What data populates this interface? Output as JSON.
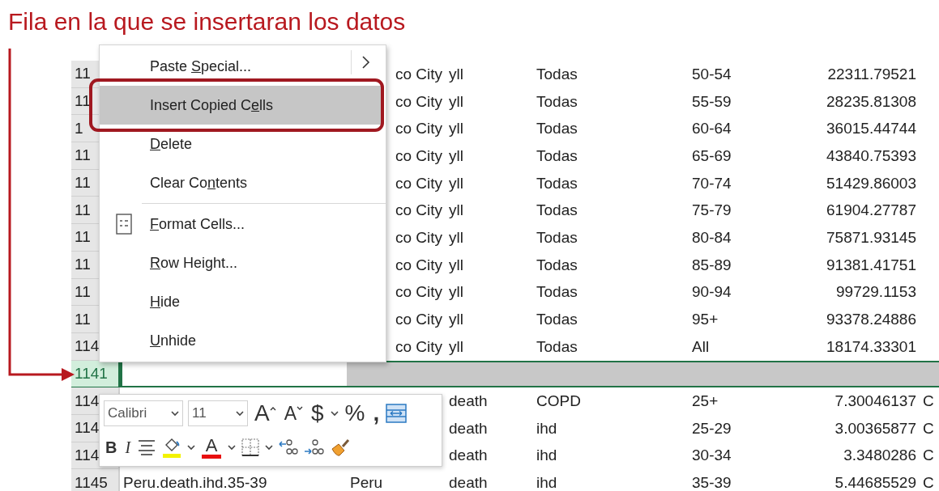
{
  "annotation": {
    "title": "Fila en la que se insertaran los datos"
  },
  "sheet": {
    "rows": [
      {
        "number": "11",
        "selected": false,
        "cut_left": true,
        "cells": {
          "c": "co City",
          "d": "yll",
          "e": "Todas",
          "f": "50-54",
          "g": "22311.79521"
        }
      },
      {
        "number": "11",
        "selected": false,
        "cut_left": true,
        "cells": {
          "c": "co City",
          "d": "yll",
          "e": "Todas",
          "f": "55-59",
          "g": "28235.81308"
        }
      },
      {
        "number": "1",
        "selected": false,
        "cut_left": true,
        "cells": {
          "c": "co City",
          "d": "yll",
          "e": "Todas",
          "f": "60-64",
          "g": "36015.44744"
        }
      },
      {
        "number": "11",
        "selected": false,
        "cut_left": true,
        "cells": {
          "c": "co City",
          "d": "yll",
          "e": "Todas",
          "f": "65-69",
          "g": "43840.75393"
        }
      },
      {
        "number": "11",
        "selected": false,
        "cut_left": true,
        "cells": {
          "c": "co City",
          "d": "yll",
          "e": "Todas",
          "f": "70-74",
          "g": "51429.86003"
        }
      },
      {
        "number": "11",
        "selected": false,
        "cut_left": true,
        "cells": {
          "c": "co City",
          "d": "yll",
          "e": "Todas",
          "f": "75-79",
          "g": "61904.27787"
        }
      },
      {
        "number": "11",
        "selected": false,
        "cut_left": true,
        "cells": {
          "c": "co City",
          "d": "yll",
          "e": "Todas",
          "f": "80-84",
          "g": "75871.93145"
        }
      },
      {
        "number": "11",
        "selected": false,
        "cut_left": true,
        "cells": {
          "c": "co City",
          "d": "yll",
          "e": "Todas",
          "f": "85-89",
          "g": "91381.41751"
        }
      },
      {
        "number": "11",
        "selected": false,
        "cut_left": true,
        "cells": {
          "c": "co City",
          "d": "yll",
          "e": "Todas",
          "f": "90-94",
          "g": "99729.1153"
        }
      },
      {
        "number": "11",
        "selected": false,
        "cut_left": true,
        "cells": {
          "c": "co City",
          "d": "yll",
          "e": "Todas",
          "f": "95+",
          "g": "93378.24886"
        }
      },
      {
        "number": "114",
        "selected": false,
        "cut_left": true,
        "cells": {
          "c": "co City",
          "d": "yll",
          "e": "Todas",
          "f": "All",
          "g": "18174.33301"
        }
      },
      {
        "number": "1141",
        "selected": true,
        "cells": {}
      },
      {
        "number": "114",
        "selected": false,
        "cells": {
          "d": "death",
          "e": "COPD",
          "f": "25+",
          "g": "7.30046137",
          "h": "C"
        }
      },
      {
        "number": "114",
        "selected": false,
        "cells": {
          "d": "death",
          "e": "ihd",
          "f": "25-29",
          "g": "3.00365877",
          "h": "C"
        }
      },
      {
        "number": "114",
        "selected": false,
        "cells": {
          "d": "death",
          "e": "ihd",
          "f": "30-34",
          "g": "3.3480286",
          "h": "C"
        }
      },
      {
        "number": "1145",
        "selected": false,
        "cells": {
          "b": "Peru.death.ihd.35-39",
          "c": "Peru",
          "d": "death",
          "e": "ihd",
          "f": "35-39",
          "g": "5.44685529",
          "h": "C"
        }
      }
    ]
  },
  "context_menu": {
    "items": [
      {
        "kind": "item",
        "before_key": "Paste ",
        "access_key": "S",
        "after_key": "pecial...",
        "highlighted": false,
        "submenu": true
      },
      {
        "kind": "item",
        "before_key": "Insert Copied C",
        "access_key": "e",
        "after_key": "lls",
        "highlighted": true,
        "framed": true
      },
      {
        "kind": "item",
        "access_key": "D",
        "after_key": "elete",
        "highlighted": false
      },
      {
        "kind": "item",
        "before_key": "Clear Co",
        "access_key": "n",
        "after_key": "tents",
        "highlighted": false
      },
      {
        "kind": "separator"
      },
      {
        "kind": "item",
        "access_key": "F",
        "after_key": "ormat Cells...",
        "highlighted": false,
        "icon": true
      },
      {
        "kind": "item",
        "access_key": "R",
        "after_key": "ow Height...",
        "highlighted": false
      },
      {
        "kind": "item",
        "access_key": "H",
        "after_key": "ide",
        "highlighted": false
      },
      {
        "kind": "item",
        "access_key": "U",
        "after_key": "nhide",
        "highlighted": false
      }
    ]
  },
  "mini_toolbar": {
    "top_row": {
      "items": [
        {
          "kind": "font",
          "value": "Calibri"
        },
        {
          "kind": "size",
          "value": "11"
        },
        {
          "kind": "grow",
          "glyph": "A"
        },
        {
          "kind": "shrink",
          "glyph": "A"
        },
        {
          "kind": "currency",
          "glyph": "$"
        },
        {
          "kind": "dropdown"
        },
        {
          "kind": "percent",
          "glyph": "%"
        },
        {
          "kind": "comma",
          "glyph": ","
        },
        {
          "kind": "wrap"
        }
      ]
    },
    "bottom_row": {
      "items": [
        {
          "kind": "bold",
          "glyph": "B"
        },
        {
          "kind": "italic",
          "glyph": "I"
        },
        {
          "kind": "align"
        },
        {
          "kind": "fill",
          "color": "#f2f200"
        },
        {
          "kind": "dropdown"
        },
        {
          "kind": "fontcolor",
          "glyph": "A",
          "color": "#e81010"
        },
        {
          "kind": "dropdown"
        },
        {
          "kind": "borders"
        },
        {
          "kind": "dropdown"
        },
        {
          "kind": "inc_decimal"
        },
        {
          "kind": "dec_decimal"
        },
        {
          "kind": "painter"
        }
      ]
    }
  }
}
